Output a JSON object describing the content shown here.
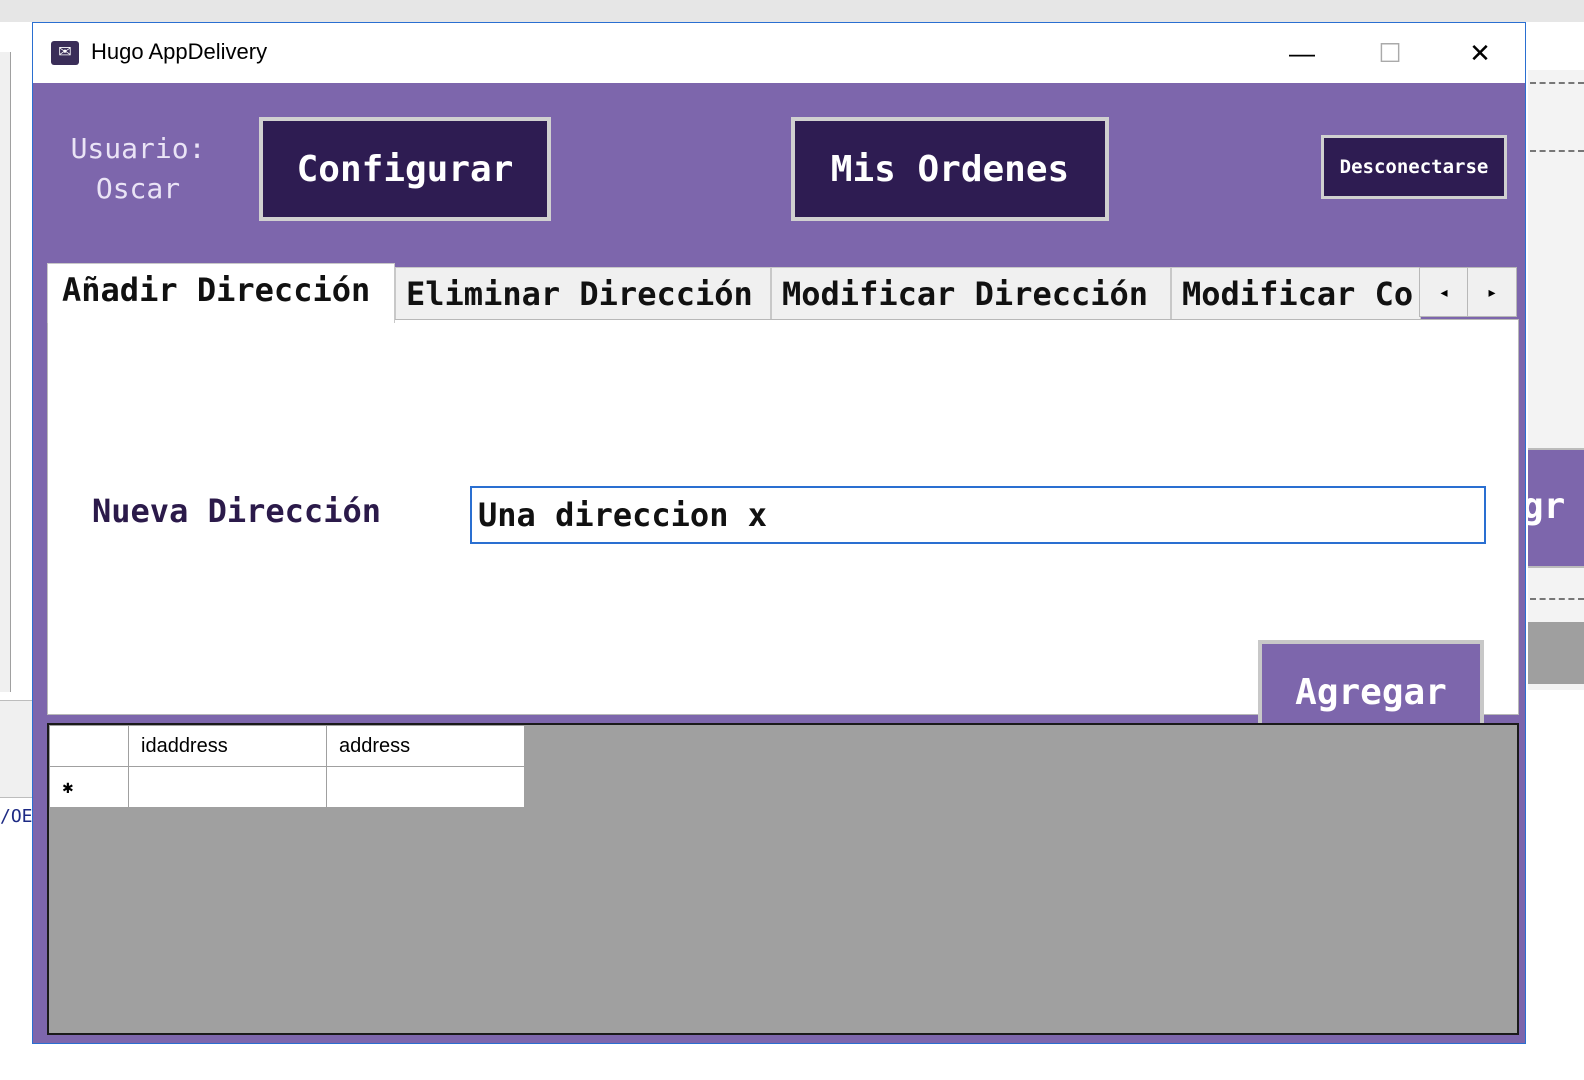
{
  "window": {
    "title": "Hugo AppDelivery",
    "controls": {
      "minimize": "—",
      "maximize": "☐",
      "close": "✕"
    }
  },
  "header": {
    "user_label": "Usuario:",
    "user_name": "Oscar",
    "configure_label": "Configurar",
    "orders_label": "Mis Ordenes",
    "logout_label": "Desconectarse"
  },
  "tabs": [
    {
      "label": "Añadir Dirección",
      "active": true
    },
    {
      "label": "Eliminar Dirección",
      "active": false
    },
    {
      "label": "Modificar Dirección",
      "active": false
    },
    {
      "label": "Modificar Co",
      "active": false
    }
  ],
  "tab_scroll": {
    "left": "◂",
    "right": "▸"
  },
  "form": {
    "new_address_label": "Nueva Dirección",
    "new_address_value": "Una direccion x",
    "add_button_label": "Agregar"
  },
  "grid": {
    "columns": [
      "idaddress",
      "address"
    ],
    "new_row_marker": "✱"
  },
  "background": {
    "left_fragment": "/OE",
    "right_fragment": "gr"
  },
  "colors": {
    "window_bg": "#7d66ac",
    "button_dark": "#2e1c52",
    "grid_bg": "#a0a0a0"
  }
}
